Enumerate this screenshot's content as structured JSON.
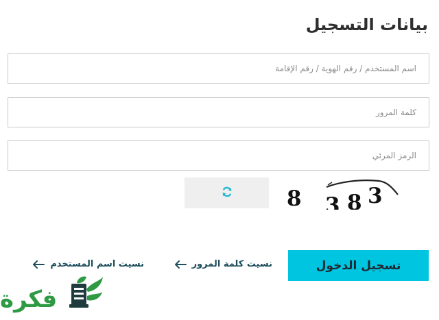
{
  "form": {
    "title": "بيانات التسجيل",
    "username_placeholder": "اسم المستخدم / رقم الهوية / رقم الإقامة",
    "password_placeholder": "كلمة المرور",
    "captcha_placeholder": "الرمز المرئي"
  },
  "captcha": {
    "text": "8 383",
    "icon": "refresh-icon"
  },
  "actions": {
    "login_label": "تسجيل الدخول",
    "forgot_password_label": "نسيت كلمة المرور",
    "forgot_username_label": "نسيت اسم المستخدم",
    "link_icon": "arrow-left-icon"
  },
  "brand": {
    "logo_text": "فكرة"
  },
  "colors": {
    "accent": "#00c5e0",
    "link": "#1f4e5e",
    "refresh_icon": "#29b6d6",
    "logo_green": "#2f9a44",
    "logo_dark": "#1f3b3e"
  }
}
